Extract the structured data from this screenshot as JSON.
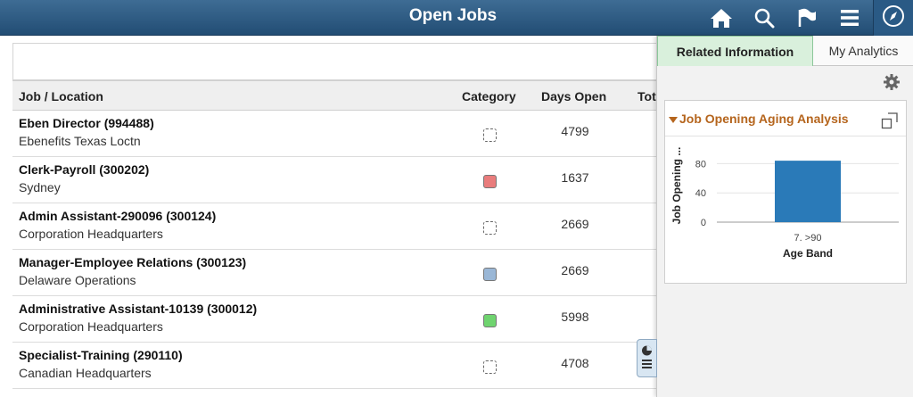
{
  "header": {
    "title": "Open Jobs",
    "icons": [
      "home-icon",
      "search-icon",
      "flag-icon",
      "menu-icon",
      "compass-icon"
    ]
  },
  "grid": {
    "columns": [
      "Job / Location",
      "Category",
      "Days Open",
      "Tot"
    ],
    "rows": [
      {
        "job": "Eben Director (994488)",
        "location": "Ebenefits Texas Loctn",
        "category": "none",
        "days": "4799"
      },
      {
        "job": "Clerk-Payroll (300202)",
        "location": "Sydney",
        "category": "red",
        "days": "1637"
      },
      {
        "job": "Admin Assistant-290096 (300124)",
        "location": "Corporation Headquarters",
        "category": "none",
        "days": "2669"
      },
      {
        "job": "Manager-Employee Relations (300123)",
        "location": "Delaware Operations",
        "category": "blue",
        "days": "2669"
      },
      {
        "job": "Administrative Assistant-10139 (300012)",
        "location": "Corporation Headquarters",
        "category": "green",
        "days": "5998"
      },
      {
        "job": "Specialist-Training (290110)",
        "location": "Canadian Headquarters",
        "category": "none",
        "days": "4708"
      }
    ],
    "category_colors": {
      "red": "#e97c7c",
      "blue": "#9ab7d6",
      "green": "#6fd46f"
    }
  },
  "panel": {
    "tabs": [
      "Related Information",
      "My Analytics"
    ],
    "active_tab": "Related Information",
    "pagelet_title": "Job Opening Aging Analysis"
  },
  "chart_data": {
    "type": "bar",
    "categories": [
      "7. >90"
    ],
    "values": [
      84
    ],
    "xlabel": "Age Band",
    "ylabel": "Job Opening ...",
    "yticks": [
      0,
      40,
      80
    ],
    "ylim": [
      0,
      100
    ],
    "color": "#2a7ab8",
    "grid": true
  }
}
